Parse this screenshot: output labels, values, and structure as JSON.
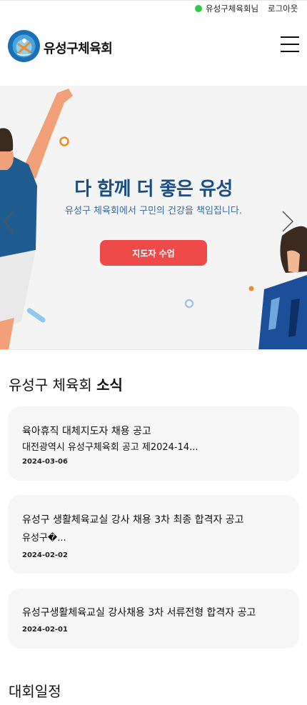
{
  "topbar": {
    "user_name": "유성구체육회님",
    "logout_label": "로그아웃",
    "online_color": "#2ecc40"
  },
  "header": {
    "site_name": "유성구체육회",
    "menu_icon": "hamburger-menu-icon"
  },
  "hero": {
    "title": "다 함께 더 좋은 유성",
    "subtitle": "유성구 체육회에서 구민의 건강을 책임집니다.",
    "button_label": "지도자 수업",
    "title_color": "#1c4e86",
    "button_color": "#ef4a4a",
    "prev_icon": "chevron-left-icon",
    "next_icon": "chevron-right-icon"
  },
  "news": {
    "title_prefix": "유성구 체육회 ",
    "title_bold": "소식",
    "items": [
      {
        "title": "육아휴직 대체지도자 채용 공고",
        "desc": "대전광역시 유성구체육회 공고 제2024-14...",
        "date": "2024-03-06"
      },
      {
        "title": "유성구 생활체육교실 강사 채용 3차 최종 합격자 공고",
        "desc": "유성구�...",
        "date": "2024-02-02"
      },
      {
        "title": "유성구생활체육교실 강사채용 3차 서류전형 합격자 공고",
        "desc": "",
        "date": "2024-02-01"
      }
    ]
  },
  "events": {
    "title": "대회일정"
  }
}
